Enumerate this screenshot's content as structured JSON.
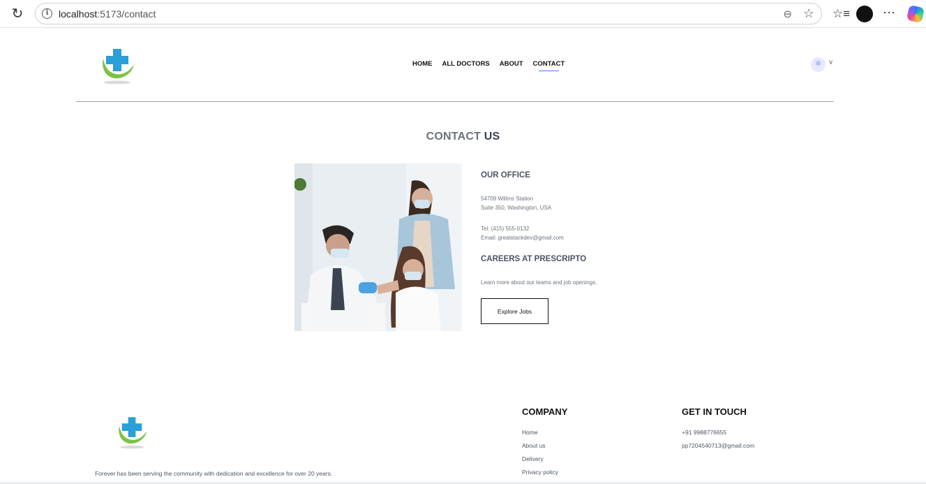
{
  "browser": {
    "url_host": "localhost",
    "url_path": ":5173/contact",
    "icons": [
      "reload-icon",
      "info-icon",
      "zoom-icon",
      "star-icon",
      "favorites-icon",
      "profile-icon",
      "more-icon",
      "copilot-icon"
    ]
  },
  "header": {
    "nav": [
      "HOME",
      "ALL DOCTORS",
      "ABOUT",
      "CONTACT"
    ],
    "active_nav": "CONTACT",
    "accent_color": "#5f6fff"
  },
  "contact": {
    "title_light": "CONTACT",
    "title_bold": "US",
    "office_heading": "OUR OFFICE",
    "address_line1": "54709 Willms Station",
    "address_line2": "Suite 350, Washington, USA",
    "tel": "Tel: (415) 555-0132",
    "email": "Email: greatstackdev@gmail.com",
    "careers_heading": "CAREERS AT PRESCRIPTO",
    "careers_text": "Learn more about our teams and job openings.",
    "button_label": "Explore Jobs"
  },
  "footer": {
    "description": "Forever has been serving the community with dedication and excellence for over 20 years.",
    "company_heading": "COMPANY",
    "company_links": [
      "Home",
      "About us",
      "Delivery",
      "Privacy policy"
    ],
    "touch_heading": "GET IN TOUCH",
    "phone": "+91 9988776655",
    "email": "pp7204540713@gmail.com"
  }
}
